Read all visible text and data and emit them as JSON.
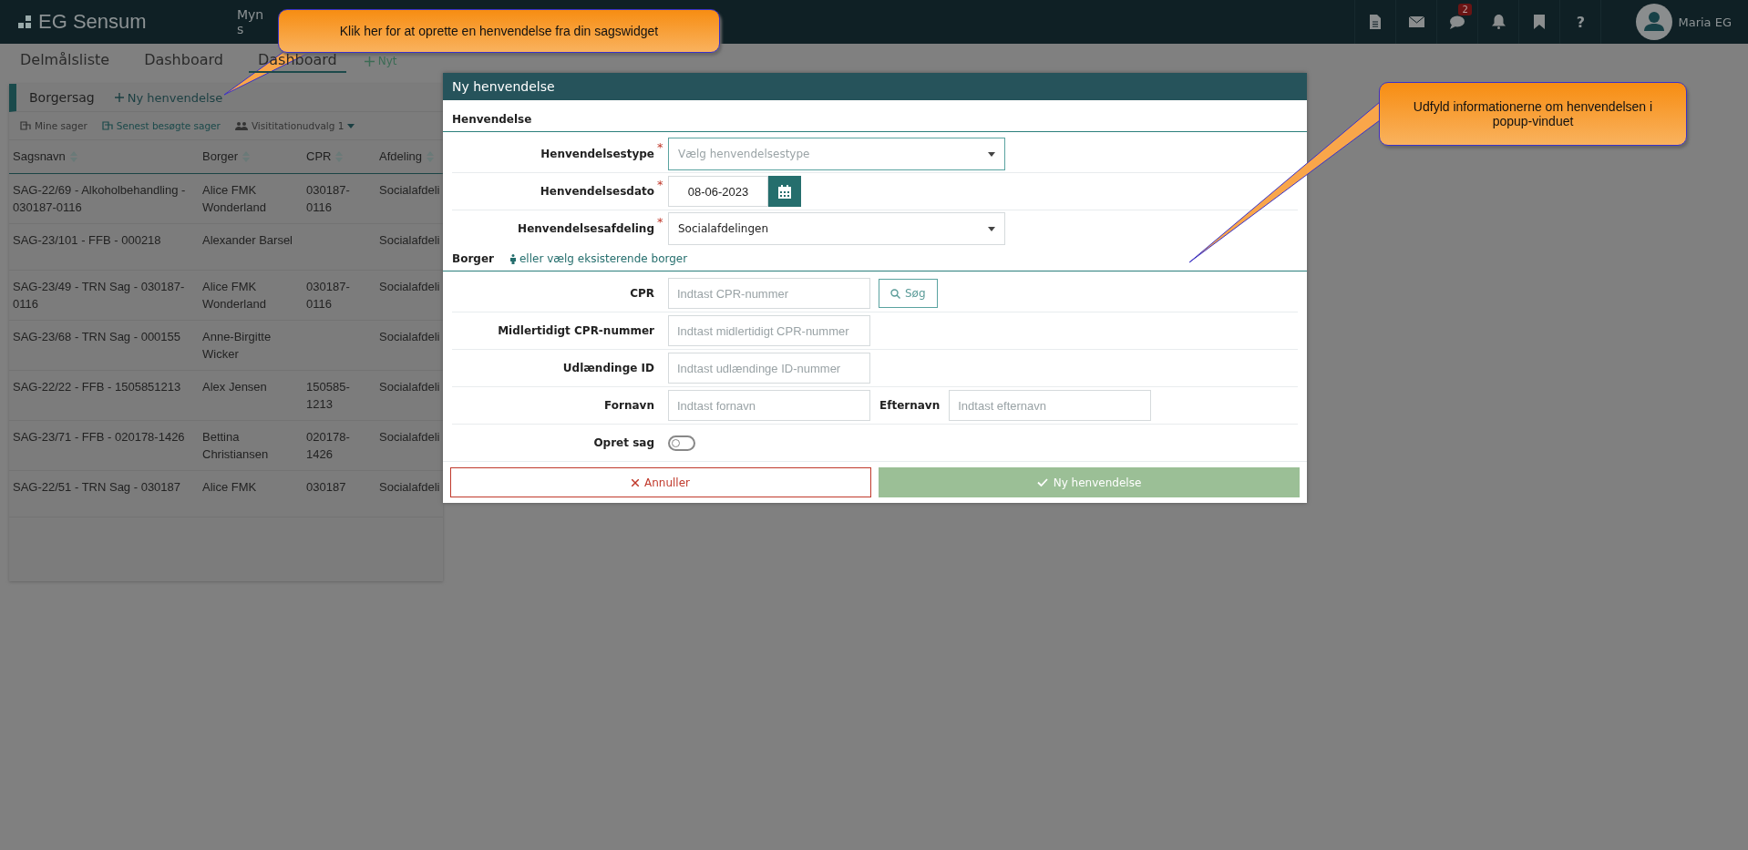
{
  "topbar": {
    "logo": "EG Sensum",
    "nav_lines": [
      "Myn",
      "s"
    ],
    "badge": "2",
    "help": "?",
    "user": "Maria EG"
  },
  "tabs": [
    {
      "label": "Delmålsliste",
      "selected": false
    },
    {
      "label": "Dashboard",
      "selected": false
    },
    {
      "label": "Dashboard",
      "selected": true
    }
  ],
  "new_tab": "Nyt",
  "widget": {
    "title": "Borgersag",
    "action": "Ny henvendelse",
    "filters": [
      {
        "kind": "list",
        "label": "Mine sager",
        "selected": false
      },
      {
        "kind": "list",
        "label": "Senest besøgte sager",
        "selected": true
      },
      {
        "kind": "group",
        "label": "Visititationudvalg 1",
        "selected": false
      }
    ],
    "columns": [
      "Sagsnavn",
      "Borger",
      "CPR",
      "Afdeling"
    ],
    "rows": [
      [
        "SAG-22/69 - Alkoholbehandling - 030187-0116",
        "Alice FMK Wonderland",
        "030187-0116",
        "Socialafdeli"
      ],
      [
        "SAG-23/101 - FFB - 000218",
        "Alexander Barsel",
        "",
        "Socialafdeli"
      ],
      [
        "SAG-23/49 - TRN Sag - 030187-0116",
        "Alice FMK Wonderland",
        "030187-0116",
        "Socialafdeli"
      ],
      [
        "SAG-23/68 - TRN Sag - 000155",
        "Anne-Birgitte Wicker",
        "",
        "Socialafdeli"
      ],
      [
        "SAG-22/22 - FFB - 1505851213",
        "Alex Jensen",
        "150585-1213",
        "Socialafdeli"
      ],
      [
        "SAG-23/71 - FFB - 020178-1426",
        "Bettina Christiansen",
        "020178-1426",
        "Socialafdeli"
      ],
      [
        "SAG-22/51 - TRN Sag - 030187",
        "Alice FMK",
        "030187",
        "Socialafdeli"
      ]
    ]
  },
  "modal": {
    "title": "Ny henvendelse",
    "section_1": "Henvendelse",
    "type": {
      "label": "Henvendelsestype",
      "marker": "*",
      "placeholder": "Vælg henvendelsestype"
    },
    "date": {
      "label": "Henvendelsesdato",
      "marker": "*",
      "value": "08-06-2023"
    },
    "department": {
      "label": "Henvendelsesafdeling",
      "marker": "*",
      "value": "Socialafdelingen"
    },
    "section_2": "Borger",
    "section_2_link": "eller vælg eksisterende borger",
    "cpr": {
      "label": "CPR",
      "placeholder": "Indtast CPR-nummer",
      "button": "Søg"
    },
    "temp_cpr": {
      "label": "Midlertidigt CPR-nummer",
      "placeholder": "Indtast midlertidigt CPR-nummer"
    },
    "foreign_id": {
      "label": "Udlændinge ID",
      "placeholder": "Indtast udlændinge ID-nummer"
    },
    "first_name": {
      "label": "Fornavn",
      "placeholder": "Indtast fornavn"
    },
    "last_name": {
      "label": "Efternavn",
      "placeholder": "Indtast efternavn"
    },
    "create_case": {
      "label": "Opret sag",
      "on": false
    },
    "cancel": "Annuller",
    "submit": {
      "label": "Ny henvendelse",
      "disabled": true
    }
  },
  "callouts": [
    {
      "text": "Klik her for at oprette en henvendelse fra din sagswidget"
    },
    {
      "text": "Udfyld informationerne om henvendelsen i popup-vinduet"
    }
  ]
}
